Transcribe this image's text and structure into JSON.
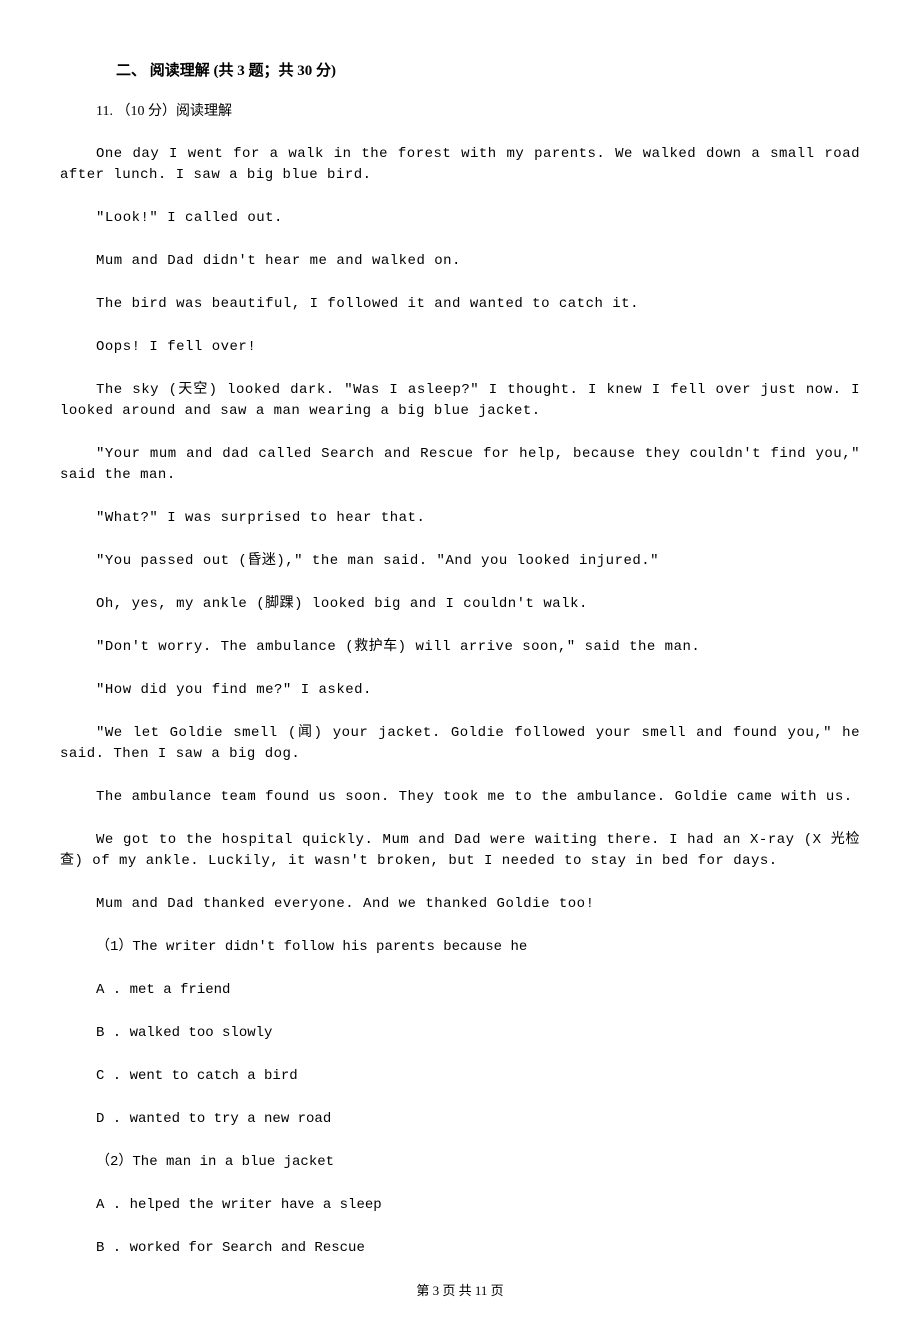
{
  "section": {
    "header": "二、 阅读理解 (共 3 题；共 30 分)"
  },
  "q11": {
    "intro": "11. （10 分）阅读理解",
    "p1": "One day I went for a walk in the forest with my parents. We walked down a small road after lunch. I saw a big blue bird.",
    "p2": "\"Look!\" I called out.",
    "p3": "Mum and Dad didn't hear me and walked on.",
    "p4": "The bird was beautiful, I followed it and wanted to catch it.",
    "p5": "Oops! I fell over!",
    "p6": "The sky (天空) looked dark. \"Was I asleep?\" I thought. I knew I fell over just now. I looked around and saw a man wearing a big blue jacket.",
    "p7": "\"Your mum and dad called Search and Rescue for help, because they couldn't find you,\" said the man.",
    "p8": "\"What?\" I was surprised to hear that.",
    "p9": "\"You passed out (昏迷),\" the man said. \"And you looked injured.\"",
    "p10": "Oh, yes, my ankle (脚踝) looked big and I couldn't walk.",
    "p11": "\"Don't worry. The ambulance (救护车) will arrive soon,\" said the man.",
    "p12": "\"How did you find me?\" I asked.",
    "p13": "\"We let Goldie smell (闻) your jacket. Goldie followed your smell and found you,\" he said. Then I saw a big dog.",
    "p14": "The ambulance team found us soon. They took me to the ambulance. Goldie came with us.",
    "p15": "We got to the hospital quickly. Mum and Dad were waiting there. I had an X-ray (X 光检查) of my ankle. Luckily, it wasn't broken, but I needed to stay in bed for days.",
    "p16": "Mum and Dad thanked everyone. And we thanked Goldie too!",
    "sub1": {
      "prompt": "（1）The writer didn't follow his parents because he",
      "a": "A . met a friend",
      "b": "B . walked too slowly",
      "c": "C . went to catch a bird",
      "d": "D . wanted to try a new road"
    },
    "sub2": {
      "prompt": "（2）The man in a blue jacket",
      "a": "A . helped the writer have a sleep",
      "b": "B . worked for Search and Rescue"
    }
  },
  "footer": "第 3 页 共 11 页"
}
